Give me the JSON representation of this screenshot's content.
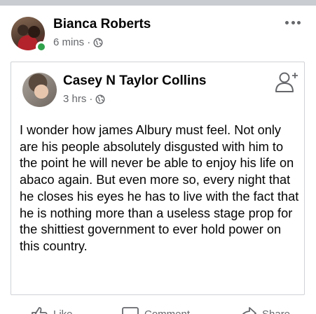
{
  "post": {
    "author": {
      "name": "Bianca Roberts",
      "time": "6 mins",
      "separator": "·",
      "online": true,
      "audience_icon": "globe-icon"
    },
    "more_icon": "more-options-icon",
    "shared": {
      "author": {
        "name": "Casey N Taylor Collins",
        "time": "3 hrs",
        "separator": "·",
        "audience_icon": "globe-icon"
      },
      "add_friend_icon": "add-friend-icon",
      "text": "I wonder how james Albury must feel. Not only are his people absolutely disgusted with him to the point he will never be able to enjoy his life on abaco again. But even more so, every night that he closes his eyes he has to live with the fact that he is nothing more than a useless stage prop for the shittiest  government to ever hold power on this country."
    },
    "actions": {
      "like": "Like",
      "comment": "Comment",
      "share": "Share"
    }
  },
  "colors": {
    "online": "#31a24c",
    "secondary_text": "#65676b",
    "card_border": "#d0d2d6"
  }
}
